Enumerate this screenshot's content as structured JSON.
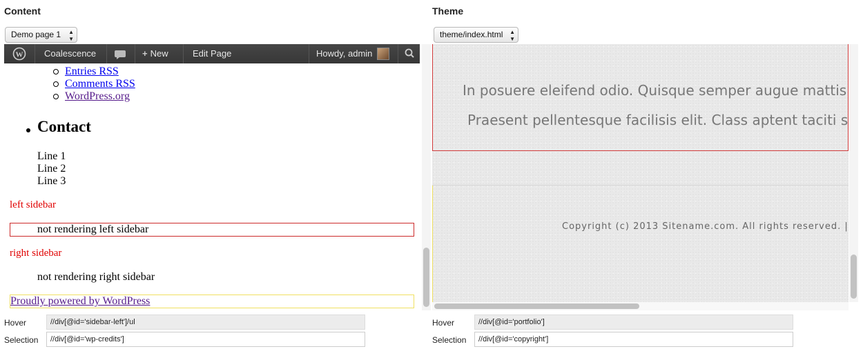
{
  "left": {
    "heading": "Content",
    "page_select": "Demo page 1",
    "adminbar": {
      "site": "Coalescence",
      "new": "New",
      "edit": "Edit Page",
      "howdy": "Howdy, admin"
    },
    "links": [
      "Entries RSS",
      "Comments RSS",
      "WordPress.org"
    ],
    "contact_heading": "Contact",
    "contact_lines": [
      "Line 1",
      "Line 2",
      "Line 3"
    ],
    "left_sidebar_label": "left sidebar",
    "left_sidebar_text": "not rendering left sidebar",
    "right_sidebar_label": "right sidebar",
    "right_sidebar_text": "not rendering right sidebar",
    "credits": "Proudly powered by WordPress",
    "hover_label": "Hover",
    "hover_value": "//div[@id='sidebar-left']/ul",
    "selection_label": "Selection",
    "selection_value": "//div[@id='wp-credits']"
  },
  "right": {
    "heading": "Theme",
    "file_select": "theme/index.html",
    "para1": "In posuere eleifend odio. Quisque semper augue mattis w",
    "para2": "Praesent pellentesque facilisis elit. Class aptent taciti soc",
    "copyright": "Copyright (c) 2013 Sitename.com. All rights reserved. |",
    "hover_label": "Hover",
    "hover_value": "//div[@id='portfolio']",
    "selection_label": "Selection",
    "selection_value": "//div[@id='copyright']"
  },
  "colors": {
    "adminbar": "#464646",
    "highlight_red": "#cc2a2a",
    "highlight_yellow": "#f0e060",
    "sidebar_label": "#e00000"
  }
}
